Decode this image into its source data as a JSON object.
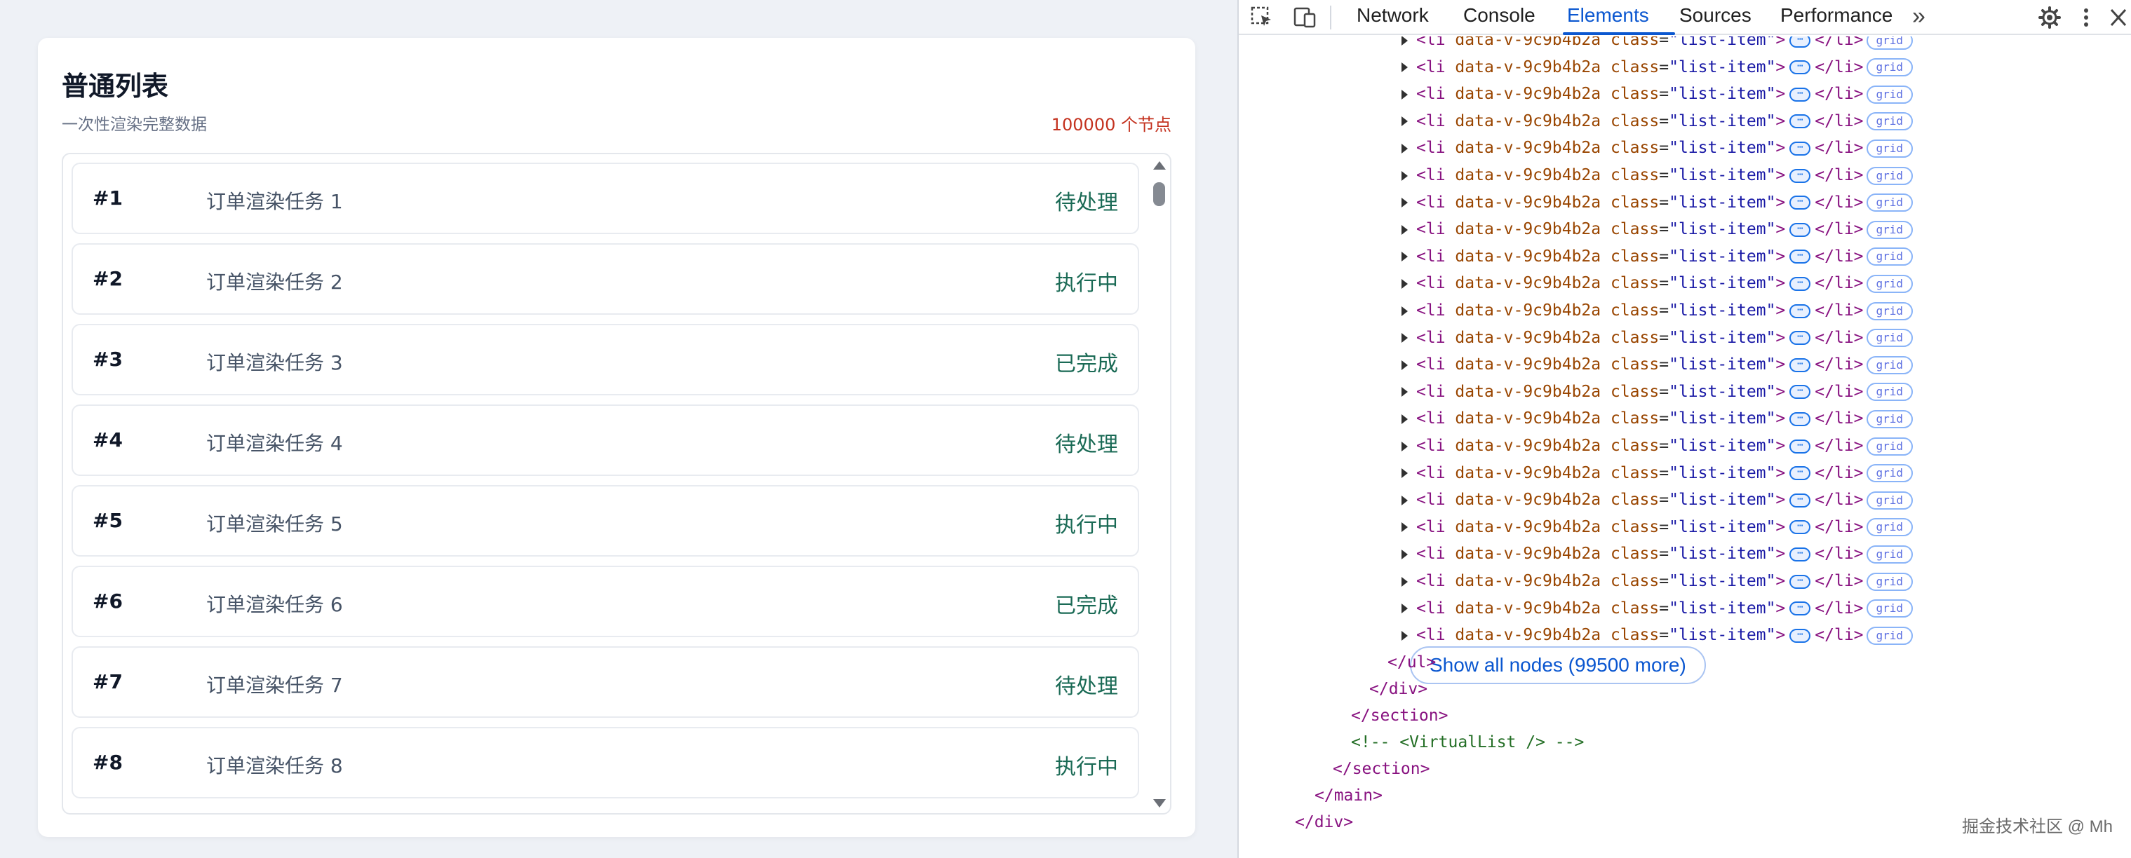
{
  "card": {
    "title": "普通列表",
    "subtitle": "一次性渲染完整数据",
    "count": "100000 个节点",
    "items": [
      {
        "id": "#1",
        "name": "订单渲染任务 1",
        "status": "待处理"
      },
      {
        "id": "#2",
        "name": "订单渲染任务 2",
        "status": "执行中"
      },
      {
        "id": "#3",
        "name": "订单渲染任务 3",
        "status": "已完成"
      },
      {
        "id": "#4",
        "name": "订单渲染任务 4",
        "status": "待处理"
      },
      {
        "id": "#5",
        "name": "订单渲染任务 5",
        "status": "执行中"
      },
      {
        "id": "#6",
        "name": "订单渲染任务 6",
        "status": "已完成"
      },
      {
        "id": "#7",
        "name": "订单渲染任务 7",
        "status": "待处理"
      },
      {
        "id": "#8",
        "name": "订单渲染任务 8",
        "status": "执行中"
      }
    ]
  },
  "devtools": {
    "tabs": [
      "Network",
      "Console",
      "Elements",
      "Sources",
      "Performance"
    ],
    "active_tab": "Elements",
    "more_tabs": "»",
    "icons": {
      "inspect": "inspect-element-icon",
      "device": "device-toolbar-icon",
      "settings": "gear-icon",
      "menu": "kebab-menu-icon",
      "close": "close-icon"
    },
    "node": {
      "tag_open": "<li",
      "attr1": "data-v-9c9b4b2a",
      "attr2": "class",
      "attr2_value": "\"list-item\"",
      "tag_close": ">",
      "ellipsis": "⋯",
      "end_tag": "</li>",
      "badge": "grid"
    },
    "node_count_visible": 23,
    "show_all": "Show all nodes (99500 more)",
    "closing_lines": [
      "</ul>",
      "</div>",
      "</section>",
      "<!-- <VirtualList /> -->",
      "</section>",
      "</main>",
      "</div>"
    ]
  },
  "watermark": "掘金技术社区 @ Mh"
}
